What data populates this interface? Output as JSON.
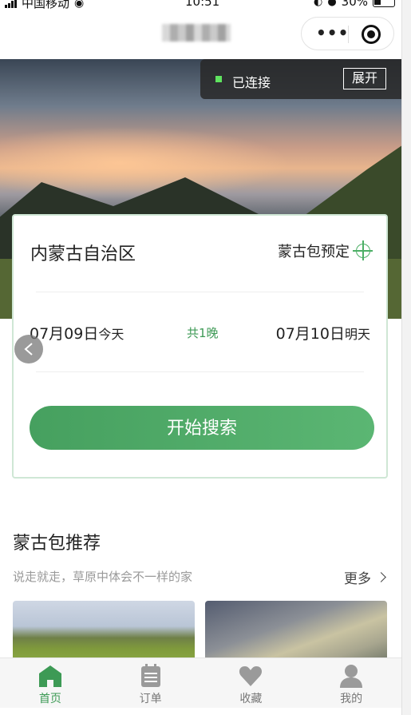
{
  "status_bar": {
    "carrier": "中国移动",
    "time": "10:51",
    "battery": "30%"
  },
  "connection": {
    "status": "已连接",
    "button": "展开"
  },
  "booking_card": {
    "region": "内蒙古自治区",
    "booking_label": "蒙古包预定",
    "check_in": {
      "date": "07月09日",
      "day": "今天"
    },
    "nights": "共1晚",
    "check_out": {
      "date": "07月10日",
      "day": "明天"
    },
    "search_button": "开始搜索"
  },
  "section": {
    "title": "蒙古包推荐",
    "subtitle": "说走就走，草原中体会不一样的家",
    "more": "更多"
  },
  "tabbar": {
    "items": [
      {
        "label": "首页",
        "icon": "home-icon",
        "active": true
      },
      {
        "label": "订单",
        "icon": "order-icon",
        "active": false
      },
      {
        "label": "收藏",
        "icon": "heart-icon",
        "active": false
      },
      {
        "label": "我的",
        "icon": "user-icon",
        "active": false
      }
    ],
    "active_color": "#3d9a55",
    "inactive_color": "#9a9a9a"
  },
  "accent_color": "#4caf66"
}
